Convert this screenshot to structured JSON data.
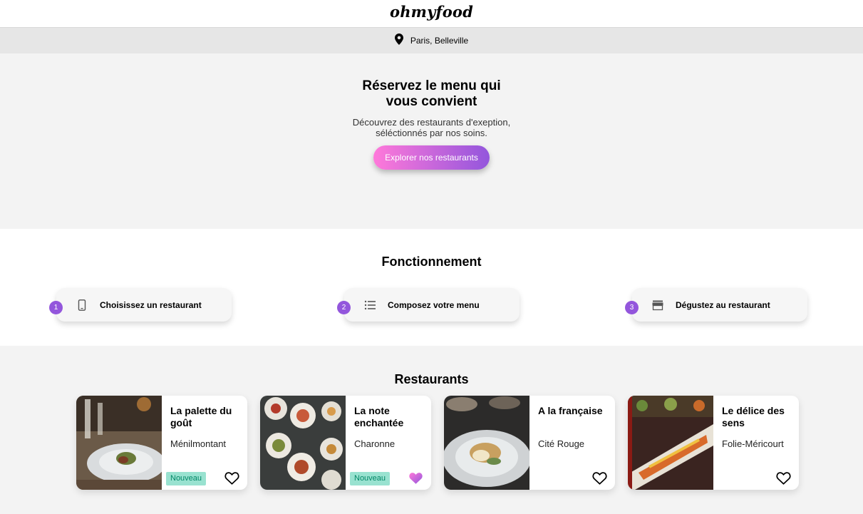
{
  "header": {
    "logo": "ohmyfood"
  },
  "location": {
    "text": "Paris, Belleville",
    "icon": "map-pin-icon"
  },
  "hero": {
    "title": "Réservez le menu qui vous convient",
    "subtitle": "Découvrez des restaurants d'exeption, séléctionnés par nos soins.",
    "cta": "Explorer nos restaurants"
  },
  "how": {
    "title": "Fonctionnement",
    "steps": [
      {
        "num": "1",
        "label": "Choisissez un restaurant",
        "icon": "smartphone-icon"
      },
      {
        "num": "2",
        "label": "Composez votre menu",
        "icon": "list-icon"
      },
      {
        "num": "3",
        "label": "Dégustez au restaurant",
        "icon": "store-icon"
      }
    ]
  },
  "restaurants": {
    "title": "Restaurants",
    "items": [
      {
        "name": "La palette du goût",
        "area": "Ménilmontant",
        "badge": "Nouveau",
        "liked": false
      },
      {
        "name": "La note enchantée",
        "area": "Charonne",
        "badge": "Nouveau",
        "liked": true
      },
      {
        "name": "A la française",
        "area": "Cité Rouge",
        "badge": "",
        "liked": false
      },
      {
        "name": "Le délice des sens",
        "area": "Folie-Méricourt",
        "badge": "",
        "liked": false
      }
    ]
  },
  "colors": {
    "accent": "#9356dc",
    "accent_light": "#ff79da",
    "badge_bg": "#99e2d0",
    "badge_text": "#008766"
  }
}
